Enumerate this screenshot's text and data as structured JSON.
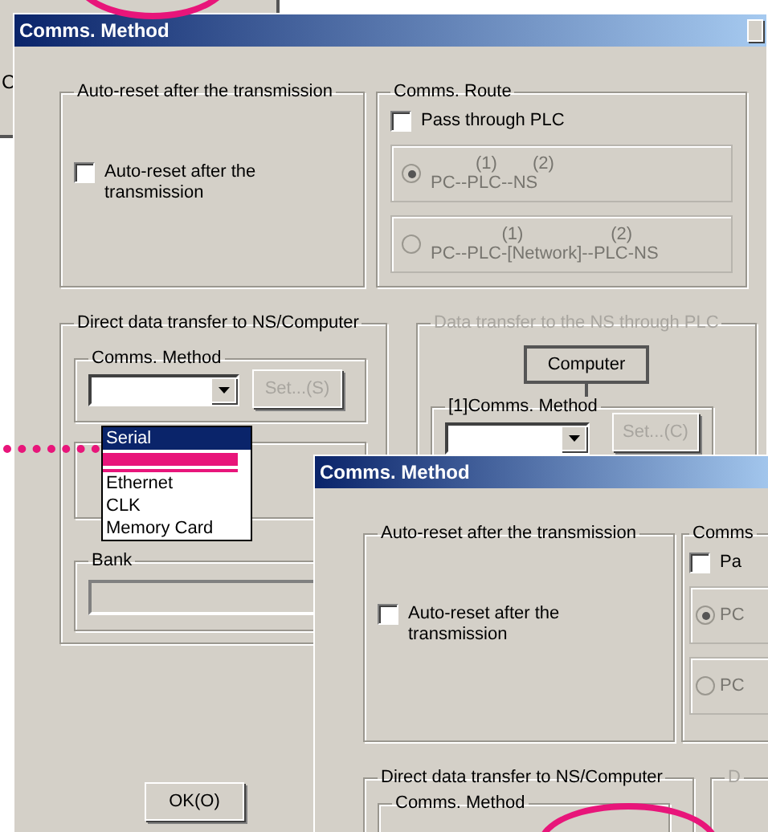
{
  "background_window": {
    "text": "C"
  },
  "main_dialog": {
    "title": "Comms. Method",
    "auto_reset": {
      "title": "Auto-reset after the transmission",
      "label": "Auto-reset after the transmission",
      "checked": false
    },
    "comms_route": {
      "title": "Comms. Route",
      "pass_through": {
        "label": "Pass through PLC",
        "checked": false
      },
      "routes": [
        {
          "marks": [
            "(1)",
            "(2)"
          ],
          "path": "PC--PLC--NS",
          "selected": true,
          "disabled": true
        },
        {
          "marks": [
            "(1)",
            "(2)"
          ],
          "path": "PC--PLC-[Network]--PLC-NS",
          "selected": false,
          "disabled": true
        }
      ]
    },
    "direct_transfer": {
      "title": "Direct data transfer to NS/Computer",
      "comms_method": {
        "title": "Comms. Method",
        "set_button": {
          "label": "Set...(S)",
          "disabled": true
        },
        "options": [
          {
            "label": "Serial",
            "selected": true,
            "covered": false
          },
          {
            "selected": false,
            "covered": true
          },
          {
            "label": "Ethernet",
            "selected": false,
            "covered": false
          },
          {
            "label": "CLK",
            "selected": false,
            "covered": false
          },
          {
            "label": "Memory Card",
            "selected": false,
            "covered": false
          }
        ]
      },
      "bank": {
        "title": "Bank"
      }
    },
    "plc_transfer": {
      "title": "Data transfer to the NS through PLC",
      "disabled": true,
      "node": "Computer",
      "comms_method": {
        "title": "[1]Comms. Method",
        "set_button": "Set...(C)"
      }
    },
    "ok_button": "OK(O)"
  },
  "front_dialog": {
    "title": "Comms. Method",
    "auto_reset": {
      "title": "Auto-reset after the transmission",
      "label": "Auto-reset after the transmission",
      "checked": false
    },
    "comms_route": {
      "title": "Comms",
      "pass_through": {
        "label": "Pa",
        "checked": false
      },
      "routes": [
        {
          "path": "PC",
          "selected": true,
          "disabled": true
        },
        {
          "path": "PC",
          "selected": false,
          "disabled": true
        }
      ]
    },
    "direct_transfer": {
      "title": "Direct data transfer to NS/Computer",
      "comms_method_title": "Comms. Method"
    },
    "plc_transfer": {
      "title": "D"
    }
  }
}
